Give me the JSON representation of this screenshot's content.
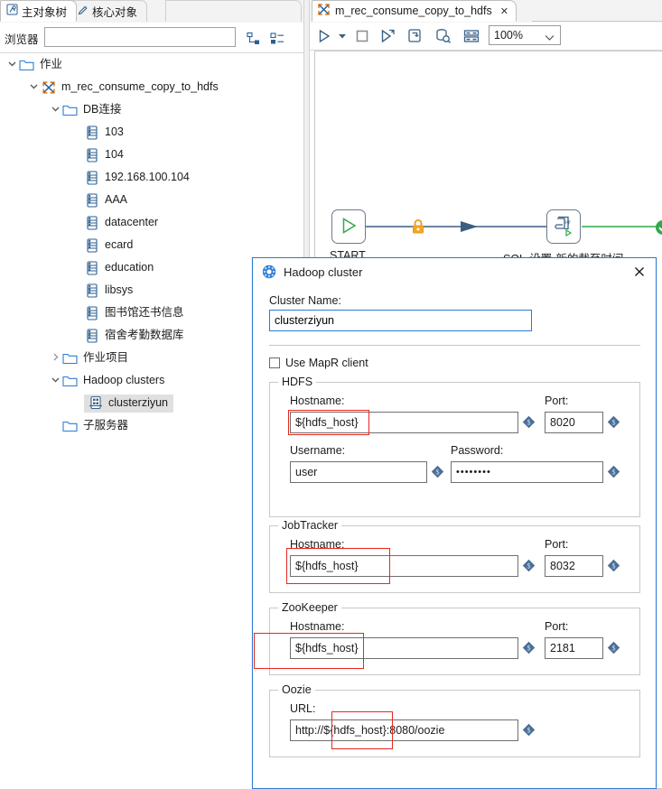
{
  "left_panel": {
    "tabs": [
      {
        "label": "主对象树",
        "icon": "tree-view-icon",
        "active": true
      },
      {
        "label": "核心对象",
        "icon": "pencil-icon",
        "active": false
      }
    ],
    "browser": {
      "label": "浏览器",
      "value": "",
      "placeholder": ""
    },
    "toolbar": [
      {
        "name": "collapse-all-icon"
      },
      {
        "name": "expand-all-icon"
      }
    ],
    "tree": [
      {
        "label": "作业",
        "depth": 0,
        "twisty": "down",
        "icon": "folder-icon",
        "selected": false
      },
      {
        "label": "m_rec_consume_copy_to_hdfs",
        "depth": 1,
        "twisty": "down",
        "icon": "job-icon",
        "selected": false
      },
      {
        "label": "DB连接",
        "depth": 2,
        "twisty": "down",
        "icon": "folder-icon",
        "selected": false
      },
      {
        "label": "103",
        "depth": 3,
        "twisty": "none",
        "icon": "database-icon",
        "selected": false
      },
      {
        "label": "104",
        "depth": 3,
        "twisty": "none",
        "icon": "database-icon",
        "selected": false
      },
      {
        "label": "192.168.100.104",
        "depth": 3,
        "twisty": "none",
        "icon": "database-icon",
        "selected": false
      },
      {
        "label": "AAA",
        "depth": 3,
        "twisty": "none",
        "icon": "database-icon",
        "selected": false
      },
      {
        "label": "datacenter",
        "depth": 3,
        "twisty": "none",
        "icon": "database-icon",
        "selected": false
      },
      {
        "label": "ecard",
        "depth": 3,
        "twisty": "none",
        "icon": "database-icon",
        "selected": false
      },
      {
        "label": "education",
        "depth": 3,
        "twisty": "none",
        "icon": "database-icon",
        "selected": false
      },
      {
        "label": "libsys",
        "depth": 3,
        "twisty": "none",
        "icon": "database-icon",
        "selected": false
      },
      {
        "label": "图书馆还书信息",
        "depth": 3,
        "twisty": "none",
        "icon": "database-icon",
        "selected": false
      },
      {
        "label": "宿舍考勤数据库",
        "depth": 3,
        "twisty": "none",
        "icon": "database-icon",
        "selected": false
      },
      {
        "label": "作业项目",
        "depth": 2,
        "twisty": "right",
        "icon": "folder-icon",
        "selected": false
      },
      {
        "label": "Hadoop clusters",
        "depth": 2,
        "twisty": "down",
        "icon": "folder-icon",
        "selected": false
      },
      {
        "label": "clusterziyun",
        "depth": 3,
        "twisty": "none",
        "icon": "hadoop-cluster-icon",
        "selected": true
      },
      {
        "label": "子服务器",
        "depth": 2,
        "twisty": "none",
        "icon": "folder-icon",
        "selected": false
      }
    ]
  },
  "editor": {
    "tab": {
      "label": "m_rec_consume_copy_to_hdfs",
      "icon": "job-icon",
      "close": "✕"
    },
    "toolbar": {
      "buttons": [
        {
          "name": "run-icon"
        },
        {
          "name": "run-dropdown-arrow-icon"
        },
        {
          "name": "stop-icon"
        },
        {
          "name": "debug-icon"
        },
        {
          "name": "preview-icon"
        },
        {
          "name": "inspect-icon"
        },
        {
          "name": "grid-icon"
        }
      ],
      "zoom_value": "100%",
      "zoom_arrow": "chevron-down-icon"
    },
    "canvas": {
      "nodes": [
        {
          "name": "start-node",
          "label": "START",
          "icon": "play-triangle-icon"
        },
        {
          "name": "sql-node",
          "label": "SQL-设置-新的截至时间",
          "icon": "sql-script-icon"
        }
      ],
      "hop_icons": [
        {
          "name": "lock-icon"
        },
        {
          "name": "arrow-head-icon"
        },
        {
          "name": "success-check-icon"
        }
      ]
    }
  },
  "dialog": {
    "title": "Hadoop cluster",
    "title_icon": "hadoop-elephant-icon",
    "close_icon": "close-icon",
    "cluster_name_label": "Cluster Name:",
    "cluster_name_value": "clusterziyun",
    "use_mapr_label": "Use MapR client",
    "use_mapr_checked": false,
    "groups": [
      {
        "title": "HDFS",
        "fields": [
          {
            "label": "Hostname:",
            "value": "${hdfs_host}",
            "variable_icon": "variable-diamond-icon",
            "highlight": true
          },
          {
            "label": "Port:",
            "value": "8020",
            "variable_icon": "variable-diamond-icon",
            "highlight": false
          },
          {
            "label": "Username:",
            "value": "user",
            "variable_icon": "variable-diamond-icon",
            "highlight": false
          },
          {
            "label": "Password:",
            "value": "••••••••",
            "variable_icon": "variable-diamond-icon",
            "highlight": false
          }
        ]
      },
      {
        "title": "JobTracker",
        "fields": [
          {
            "label": "Hostname:",
            "value": "${hdfs_host}",
            "variable_icon": "variable-diamond-icon",
            "highlight": true
          },
          {
            "label": "Port:",
            "value": "8032",
            "variable_icon": "variable-diamond-icon",
            "highlight": false
          }
        ]
      },
      {
        "title": "ZooKeeper",
        "fields": [
          {
            "label": "Hostname:",
            "value": "${hdfs_host}",
            "variable_icon": "variable-diamond-icon",
            "highlight": true
          },
          {
            "label": "Port:",
            "value": "2181",
            "variable_icon": "variable-diamond-icon",
            "highlight": false
          }
        ]
      },
      {
        "title": "Oozie",
        "fields": [
          {
            "label": "URL:",
            "value": "http://${hdfs_host}:8080/oozie",
            "variable_icon": "variable-diamond-icon",
            "highlight": true
          }
        ]
      }
    ]
  },
  "colors": {
    "accent": "#2b7cd3",
    "highlight_red": "#e8281e",
    "node_green": "#2eaa4a",
    "lock_orange": "#e79a20",
    "hop_blue": "#3b5f80",
    "selection_gray": "#e0e0e0"
  }
}
